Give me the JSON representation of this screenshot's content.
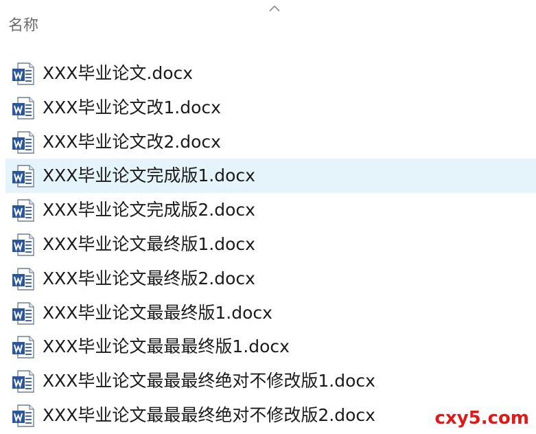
{
  "header": {
    "column_name_label": "名称",
    "sort_icon": "chevron-up-icon"
  },
  "files": [
    {
      "name": "XXX毕业论文.docx",
      "icon": "word-doc-icon",
      "selected": false
    },
    {
      "name": "XXX毕业论文改1.docx",
      "icon": "word-doc-icon",
      "selected": false
    },
    {
      "name": "XXX毕业论文改2.docx",
      "icon": "word-doc-icon",
      "selected": false
    },
    {
      "name": "XXX毕业论文完成版1.docx",
      "icon": "word-doc-icon",
      "selected": true
    },
    {
      "name": "XXX毕业论文完成版2.docx",
      "icon": "word-doc-icon",
      "selected": false
    },
    {
      "name": "XXX毕业论文最终版1.docx",
      "icon": "word-doc-icon",
      "selected": false
    },
    {
      "name": "XXX毕业论文最终版2.docx",
      "icon": "word-doc-icon",
      "selected": false
    },
    {
      "name": "XXX毕业论文最最终版1.docx",
      "icon": "word-doc-icon",
      "selected": false
    },
    {
      "name": "XXX毕业论文最最最终版1.docx",
      "icon": "word-doc-icon",
      "selected": false
    },
    {
      "name": "XXX毕业论文最最最终绝对不修改版1.docx",
      "icon": "word-doc-icon",
      "selected": false
    },
    {
      "name": "XXX毕业论文最最最终绝对不修改版2.docx",
      "icon": "word-doc-icon",
      "selected": false
    }
  ],
  "watermark": "cxy5.com",
  "colors": {
    "selected_row": "#e5f3fb",
    "header_text": "#6b6b6b",
    "word_blue": "#2b579a",
    "watermark_red": "#e01818"
  }
}
